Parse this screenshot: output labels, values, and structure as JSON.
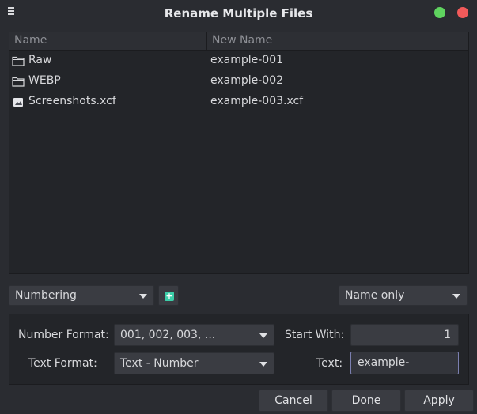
{
  "window": {
    "title": "Rename Multiple Files"
  },
  "list": {
    "columns": [
      "Name",
      "New Name"
    ],
    "rows": [
      {
        "icon": "folder-icon",
        "name": "Raw",
        "new_name": "example-001"
      },
      {
        "icon": "folder-icon",
        "name": "WEBP",
        "new_name": "example-002"
      },
      {
        "icon": "image-file-icon",
        "name": "Screenshots.xcf",
        "new_name": "example-003.xcf"
      }
    ]
  },
  "controls": {
    "mode": "Numbering",
    "scope": "Name only"
  },
  "options": {
    "number_format_label": "Number Format:",
    "number_format_value": "001, 002, 003, ...",
    "start_with_label": "Start With:",
    "start_with_value": "1",
    "text_format_label": "Text Format:",
    "text_format_value": "Text - Number",
    "text_label": "Text:",
    "text_value": "example-"
  },
  "buttons": {
    "cancel": "Cancel",
    "done": "Done",
    "apply": "Apply"
  },
  "colors": {
    "window_bg": "#2a2c31",
    "list_bg": "#232529",
    "maximize": "#5fd35f",
    "close": "#f25a5a",
    "accent_add": "#3ccfa9"
  }
}
